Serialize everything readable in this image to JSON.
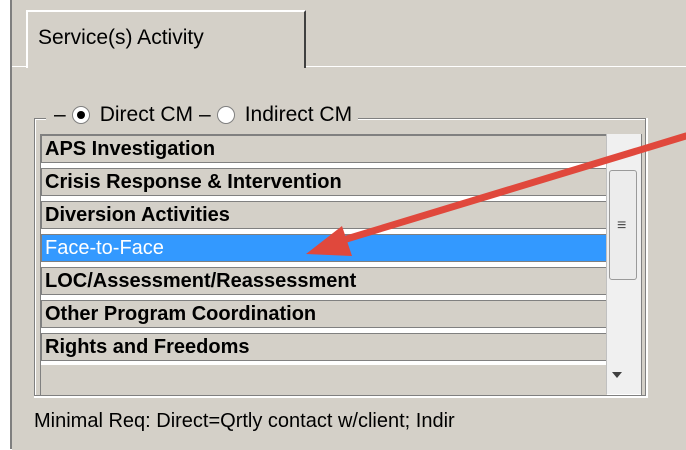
{
  "tab": {
    "label": "Service(s) Activity"
  },
  "group": {
    "options": [
      {
        "label": "Direct CM",
        "checked": true
      },
      {
        "label": "Indirect CM",
        "checked": false
      }
    ]
  },
  "list": {
    "items": [
      {
        "label": "APS Investigation"
      },
      {
        "label": "Crisis Response & Intervention"
      },
      {
        "label": "Diversion Activities"
      },
      {
        "label": "Face-to-Face",
        "selected": true
      },
      {
        "label": "LOC/Assessment/Reassessment"
      },
      {
        "label": "Other Program Coordination"
      },
      {
        "label": "Rights and Freedoms"
      }
    ]
  },
  "footer": {
    "text": "Minimal Req: Direct=Qrtly contact w/client; Indir"
  },
  "colors": {
    "selection": "#3399ff",
    "annotation_arrow": "#e0483c",
    "panel": "#d4d0c8"
  },
  "icons": {
    "scroll_grip": "grip-icon",
    "scroll_down": "scroll-down-icon"
  }
}
